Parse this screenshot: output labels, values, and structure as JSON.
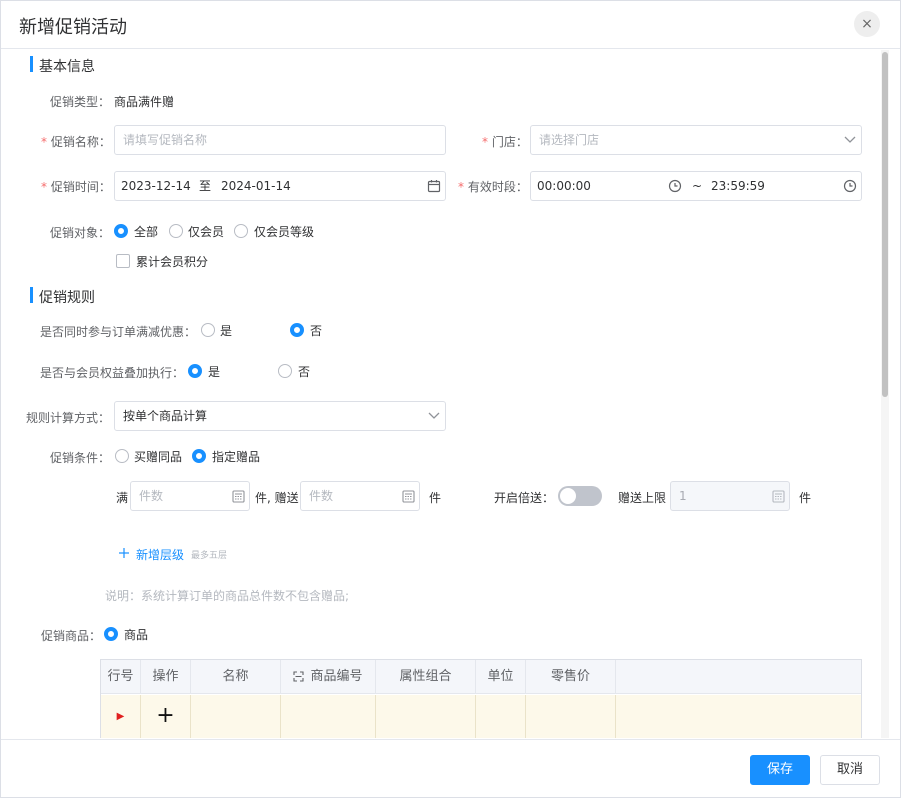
{
  "dialog": {
    "title": "新增促销活动",
    "close_glyph": "×"
  },
  "sections": {
    "basic": "基本信息",
    "rules": "促销规则"
  },
  "basic": {
    "type_label": "促销类型：",
    "type_value": "商品满件赠",
    "name_label": "促销名称：",
    "name_placeholder": "请填写促销名称",
    "store_label": "门店：",
    "store_placeholder": "请选择门店",
    "time_label": "促销时间：",
    "start_date": "2023-12-14",
    "date_sep": "至",
    "end_date": "2024-01-14",
    "period_label": "有效时段：",
    "start_time": "00:00:00",
    "time_sep": "~",
    "end_time": "23:59:59",
    "target_label": "促销对象：",
    "target_options": [
      "全部",
      "仅会员",
      "仅会员等级"
    ],
    "points_label": "累计会员积分",
    "required_mark": "*"
  },
  "rules": {
    "order_discount_label": "是否同时参与订单满减优惠：",
    "member_benefit_label": "是否与会员权益叠加执行：",
    "yes": "是",
    "no": "否",
    "calc_label": "规则计算方式：",
    "calc_value": "按单个商品计算",
    "condition_label": "促销条件：",
    "condition_options": [
      "买赠同品",
      "指定赠品"
    ],
    "full_label": "满",
    "count_placeholder": "件数",
    "unit_gift_label": "件, 赠送",
    "unit_label": "件",
    "double_label": "开启倍送：",
    "limit_label": "赠送上限",
    "limit_value": "1",
    "add_level_label": "新增层级",
    "add_level_hint": "最多五层",
    "note": "说明：系统计算订单的商品总件数不包含赠品;",
    "product_label": "促销商品：",
    "product_option": "商品"
  },
  "table": {
    "columns": [
      "行号",
      "操作",
      "名称",
      "商品编号",
      "属性组合",
      "单位",
      "零售价"
    ],
    "row_marker": "▶",
    "add_glyph": "+"
  },
  "footer": {
    "save": "保存",
    "cancel": "取消"
  },
  "colors": {
    "accent": "#1890ff",
    "required": "#f56c6c"
  }
}
